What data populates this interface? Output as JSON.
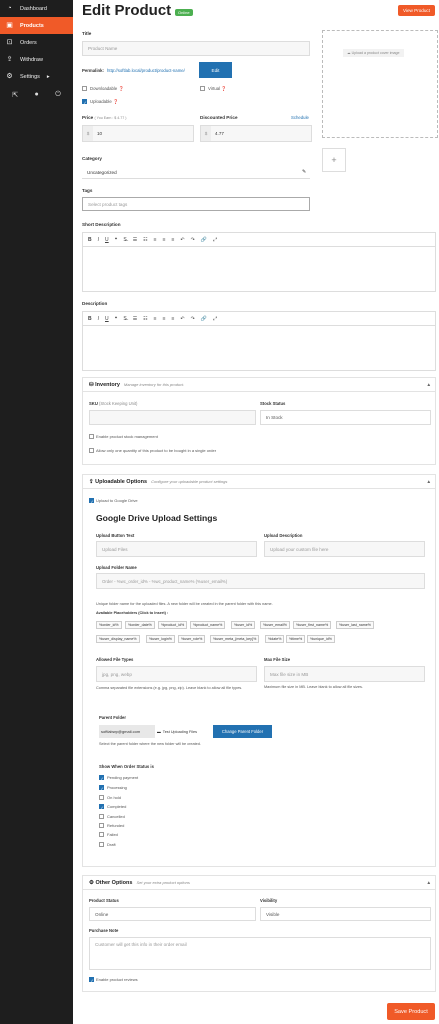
{
  "sidebar": {
    "items": [
      {
        "label": "Dashboard",
        "icon": "dashboard-icon"
      },
      {
        "label": "Products",
        "icon": "briefcase-icon"
      },
      {
        "label": "Orders",
        "icon": "cart-icon"
      },
      {
        "label": "Withdraw",
        "icon": "upload-icon"
      },
      {
        "label": "Settings",
        "icon": "gear-icon"
      }
    ]
  },
  "header": {
    "title": "Edit Product",
    "status_badge": "Online",
    "view_button": "View Product"
  },
  "title": {
    "label": "Title",
    "placeholder": "Product Name"
  },
  "permalink": {
    "label": "Permalink:",
    "url": "http://softlab.local/product/product-name/",
    "edit_button": "Edit"
  },
  "options": {
    "downloadable": "Downloadable",
    "virtual": "Virtual",
    "uploadable": "Uploadable"
  },
  "price": {
    "label": "Price",
    "hint": "( You Earn : $ 4.77 )",
    "currency": "$",
    "value": "10"
  },
  "discount": {
    "label": "Discounted Price",
    "schedule": "Schedule",
    "currency": "$",
    "value": "4.77"
  },
  "image": {
    "upload_label": "Upload a product cover image"
  },
  "category": {
    "label": "Category",
    "value": "Uncategorized"
  },
  "tags": {
    "label": "Tags",
    "placeholder": "Select product tags"
  },
  "short_desc": {
    "label": "Short Description"
  },
  "desc": {
    "label": "Description"
  },
  "inventory": {
    "title": "Inventory",
    "subtitle": "Manage inventory for this product.",
    "sku_label": "SKU",
    "sku_hint": "(Stock Keeping Unit)",
    "stock_label": "Stock Status",
    "stock_value": "In Stock",
    "manage": "Enable product stock management",
    "single": "Allow only one quantity of this product to be bought in a single order"
  },
  "uploadable": {
    "title": "Uploadable Options",
    "subtitle": "Configure your uploadable product settings",
    "google": "Upload to Google Drive",
    "gd_title": "Google Drive Upload Settings",
    "btn_text_label": "Upload Button Text",
    "btn_text_ph": "Upload Files",
    "desc_label": "Upload Description",
    "desc_ph": "Upload your custom file here",
    "folder_label": "Upload Folder Name",
    "folder_ph": "Order - %wc_order_id% - %wc_product_name% (%user_email%)",
    "folder_hint": "Unique folder name for the uploaded files. A new folder will be created in the parent folder with this name.",
    "placeholders_label": "Available Placeholders (Click to Insert) :",
    "placeholders": [
      "%order_id%",
      "%order_date%",
      "%product_id%",
      "%product_name%",
      "%user_id%",
      "%user_email%",
      "%user_first_name%",
      "%user_last_name%",
      "%user_display_name%",
      "%user_login%",
      "%user_role%",
      "%user_meta_{meta_key}%",
      "%date%",
      "%time%",
      "%unique_id%"
    ],
    "types_label": "Allowed File Types",
    "types_ph": "jpg, png, webp",
    "types_hint": "Comma separated file extensions (e.g. jpg, png, zip). Leave blank to allow all file types.",
    "size_label": "Max File Size",
    "size_ph": "Max file size in MB",
    "size_hint": "Maximum file size in MB. Leave blank to allow all file sizes.",
    "parent_label": "Parent Folder",
    "parent_email": "softlabwp@gmail.com",
    "parent_folder": "Test Uploading Files",
    "change_btn": "Change Parent Folder",
    "parent_hint": "Select the parent folder where the new folder will be created.",
    "status_label": "Show When Order Status is",
    "statuses": [
      {
        "label": "Pending payment",
        "on": true
      },
      {
        "label": "Processing",
        "on": true
      },
      {
        "label": "On hold",
        "on": false
      },
      {
        "label": "Completed",
        "on": true
      },
      {
        "label": "Cancelled",
        "on": false
      },
      {
        "label": "Refunded",
        "on": false
      },
      {
        "label": "Failed",
        "on": false
      },
      {
        "label": "Draft",
        "on": false
      }
    ]
  },
  "other": {
    "title": "Other Options",
    "subtitle": "Set your extra product options",
    "status_label": "Product Status",
    "status_value": "Online",
    "visibility_label": "Visibility",
    "visibility_value": "Visible",
    "note_label": "Purchase Note",
    "note_ph": "Customer will get this info in their order email",
    "reviews": "Enable product reviews"
  },
  "save_button": "Save Product"
}
